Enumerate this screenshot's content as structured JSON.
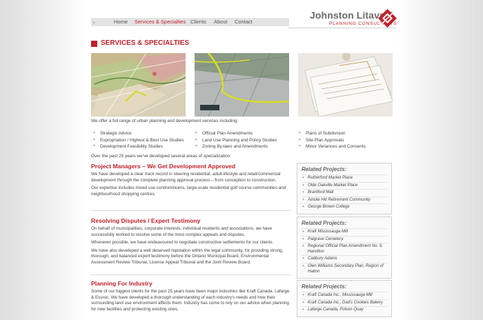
{
  "nav": {
    "items": [
      {
        "label": "Home",
        "active": false
      },
      {
        "label": "Services & Specialties",
        "active": true
      },
      {
        "label": "Clients",
        "active": false
      },
      {
        "label": "About",
        "active": false
      },
      {
        "label": "Contact",
        "active": false
      }
    ]
  },
  "logo": {
    "name": "Johnston Litavski",
    "tagline": "PLANNING CONSULTANTS",
    "accent": "#c0202a"
  },
  "page_title": "SERVICES & SPECIALTIES",
  "photos": [
    {
      "icon": "subdivision-map-photo"
    },
    {
      "icon": "farm-map-photo"
    },
    {
      "icon": "document-stack-photo"
    }
  ],
  "intro": "We offer a full range of urban planning and development services including:",
  "services": [
    [
      "Strategic Advice",
      "Expropriation / Highest & Best Use Studies",
      "Development Feasibility Studies"
    ],
    [
      "Official Plan Amendments",
      "Land Use Planning and Policy Studies",
      "Zoning By-laws and Amendments"
    ],
    [
      "Plans of Subdivision",
      "Site Plan Approvals",
      "Minor Variances and Consents"
    ]
  ],
  "specialization_intro": "Over the past 25 years we've developed several areas of specialization:",
  "sections": [
    {
      "title": "Project Managers – We Get Development Approved",
      "paragraphs": [
        "We have developed a clear track record in steering residential, adult-lifestyle and retail/commercial development through the complete planning approval process – from conception to construction.",
        "Our expertise includes mixed use condominiums, large-scale residential golf course communities and neighbourhood shopping centres."
      ],
      "related_title": "Related Projects:",
      "related": [
        "Rutherford Market Place",
        "Olde Oakville Market Place",
        "Brantford Mall",
        "Ainslie Hill Retirement Community",
        "George Brown College"
      ]
    },
    {
      "title": "Resolving Disputes / Expert Testimony",
      "paragraphs": [
        "On behalf of municipalities, corporate interests, individual residents and associations, we have successfully worked to resolve some of the most complex appeals and disputes.",
        "Whenever possible, we have endeavoured to negotiate constructive settlements for our clients.",
        "We have also developed a well deserved reputation within the legal community, for providing strong, thorough, and balanced expert testimony before the Ontario Municipal Board, Environmental Assessment Review Tribunal, License Appeal Tribunal and the Joint Review Board."
      ],
      "related_title": "Related Projects:",
      "related": [
        "Kraft Mississauga Mill",
        "Palgrave Cemetery",
        "Regional Official Plan Amendment No. 9, Hamilton",
        "Cadbury Adams",
        "Glen Williams Secondary Plan, Region of Halton"
      ]
    },
    {
      "title": "Planning For Industry",
      "paragraphs": [
        "Some of our biggest clients for the past 25 years have been major industries like Kraft Canada, Lafarge & Essroc.  We have developed a thorough understanding of each industry's needs and how their surrounding land use environment affects them.  Industry has come to rely on our advice when planning for new facilities and protecting existing ones."
      ],
      "related_title": "Related Projects:",
      "related": [
        "Kraft Canada Inc., Mississauga Mill",
        "Kraft Canada Inc., Dad's Cookies Bakery",
        "Lafarge Canada, Polson Quay"
      ]
    }
  ]
}
